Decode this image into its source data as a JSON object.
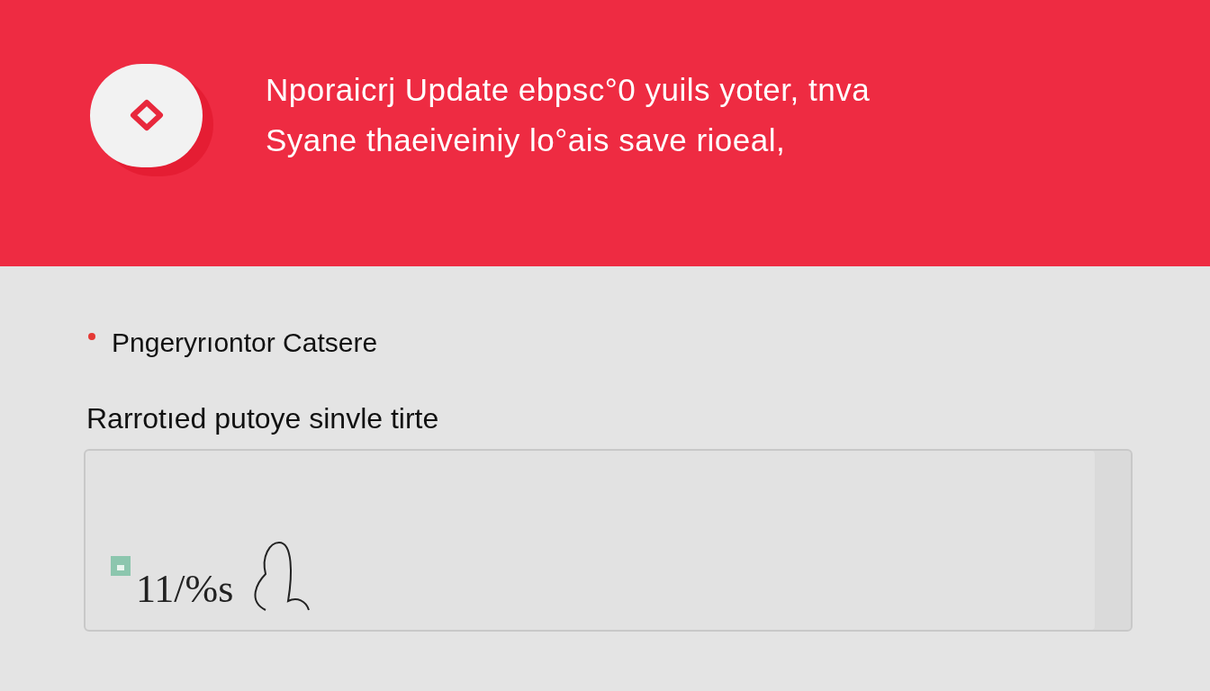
{
  "banner": {
    "lines": [
      "Nporaicrj Update ebpsc°0 yuils yoter, tnva",
      "Syane thaeiveiniy lo°ais save rioeal,"
    ]
  },
  "bullets": [
    {
      "label": "Pngeryrıontor Catsere"
    }
  ],
  "field": {
    "label": "Rarrotıed putoye sinvle tirte",
    "value": "11/%s"
  }
}
